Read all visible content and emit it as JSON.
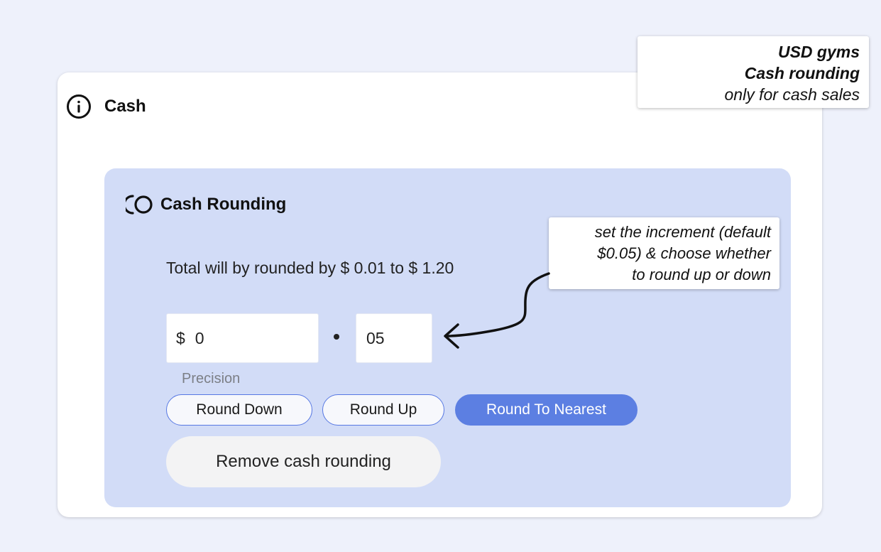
{
  "card": {
    "title": "Cash",
    "icon": "info-icon"
  },
  "cash_rounding": {
    "title": "Cash Rounding",
    "icon": "cash-rounding-icon",
    "range_text": "Total will by rounded by $ 0.01 to $ 1.20",
    "increment": {
      "currency_symbol": "$",
      "dollars_value": "0",
      "cents_value": "05",
      "label": "Precision"
    },
    "modes": [
      {
        "label": "Round Down",
        "selected": false
      },
      {
        "label": "Round Up",
        "selected": false
      },
      {
        "label": "Round To Nearest",
        "selected": true
      }
    ],
    "remove_label": "Remove cash rounding"
  },
  "annotations": {
    "top_note": {
      "line1": "USD gyms",
      "line2": "Cash rounding",
      "line3": "only for cash sales"
    },
    "increment_note": {
      "line1": "set the increment (default",
      "line2": "$0.05) & choose whether",
      "line3": "to round up or down"
    }
  },
  "colors": {
    "page_background": "#eef1fb",
    "panel_background": "#d2dcf7",
    "accent": "#5c7fe2",
    "button_border": "#5778e3"
  }
}
